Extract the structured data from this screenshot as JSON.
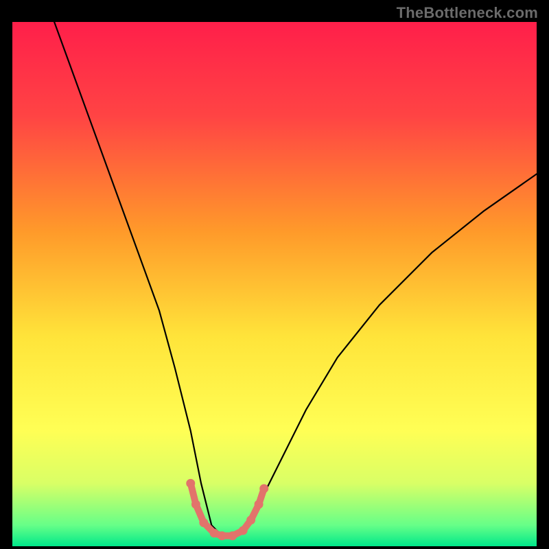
{
  "watermark": "TheBottleneck.com",
  "chart_data": {
    "type": "line",
    "title": "",
    "xlabel": "",
    "ylabel": "",
    "xlim": [
      0,
      100
    ],
    "ylim": [
      0,
      100
    ],
    "background_gradient": {
      "stops": [
        {
          "offset": 0.0,
          "color": "#ff1f4a"
        },
        {
          "offset": 0.18,
          "color": "#ff4444"
        },
        {
          "offset": 0.4,
          "color": "#ff9a2a"
        },
        {
          "offset": 0.6,
          "color": "#ffe43a"
        },
        {
          "offset": 0.78,
          "color": "#ffff55"
        },
        {
          "offset": 0.88,
          "color": "#d9ff66"
        },
        {
          "offset": 0.96,
          "color": "#66ff88"
        },
        {
          "offset": 1.0,
          "color": "#00e88a"
        }
      ]
    },
    "series": [
      {
        "name": "bottleneck-curve",
        "color": "#000000",
        "stroke_width": 2.2,
        "x": [
          8,
          12,
          16,
          20,
          24,
          28,
          31,
          34,
          36,
          38,
          40,
          42,
          45,
          48,
          52,
          56,
          62,
          70,
          80,
          90,
          100
        ],
        "values": [
          100,
          89,
          78,
          67,
          56,
          45,
          34,
          22,
          12,
          4,
          2,
          2,
          4,
          10,
          18,
          26,
          36,
          46,
          56,
          64,
          71
        ]
      },
      {
        "name": "sweet-spot-band",
        "color": "#e2736b",
        "stroke_width": 10,
        "x": [
          34.0,
          35.0,
          36.5,
          38.5,
          40.0,
          42.0,
          44.0,
          45.5,
          47.0,
          48.0
        ],
        "values": [
          12.0,
          8.0,
          4.5,
          2.5,
          2.0,
          2.0,
          3.0,
          5.0,
          8.0,
          11.0
        ]
      }
    ],
    "sweet_spot_dots": {
      "color": "#e2736b",
      "radius": 6.5,
      "x": [
        34.0,
        35.0,
        36.5,
        38.5,
        40.0,
        42.0,
        44.0,
        45.5,
        47.0,
        48.0
      ],
      "values": [
        12.0,
        8.0,
        4.5,
        2.5,
        2.0,
        2.0,
        3.0,
        5.0,
        8.0,
        11.0
      ]
    }
  }
}
